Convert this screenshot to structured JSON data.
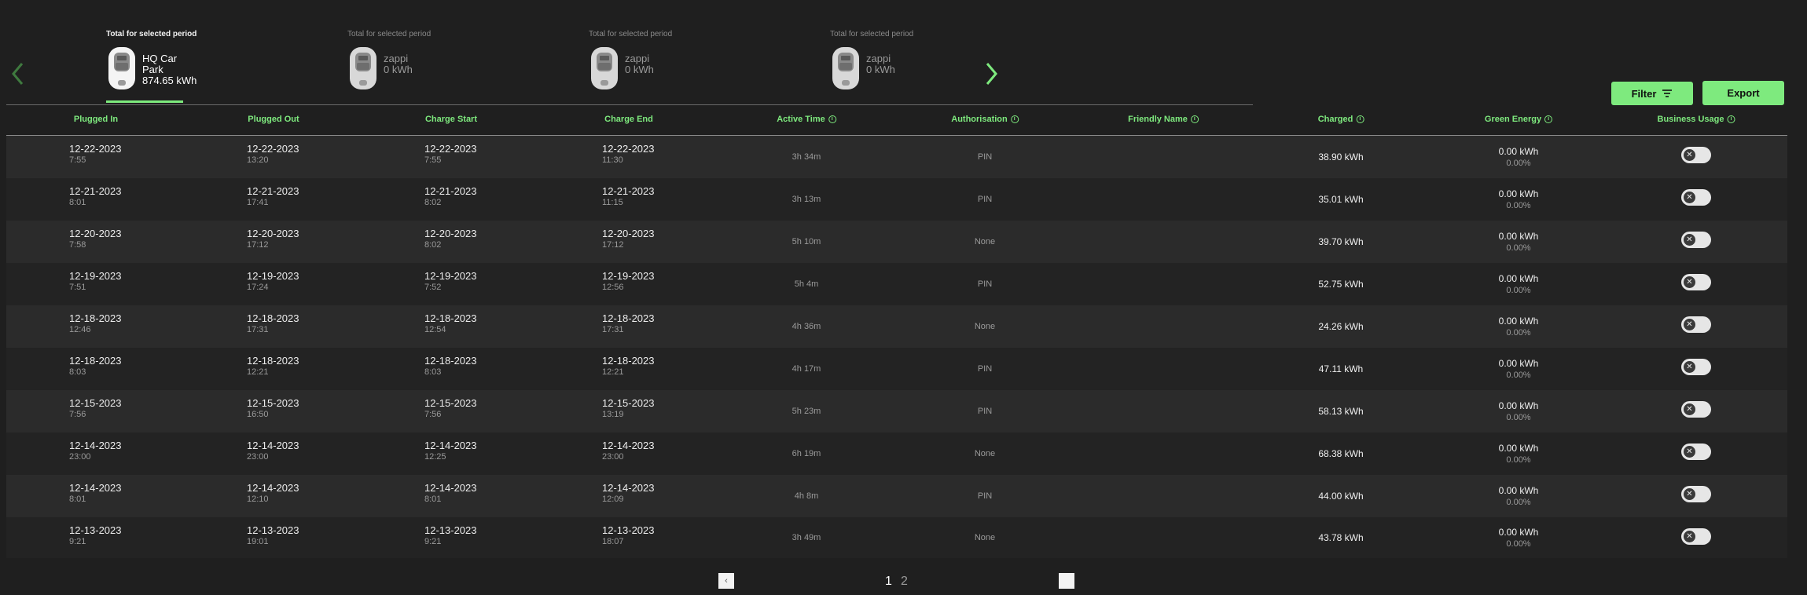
{
  "chargers": [
    {
      "period_label": "Total for selected period",
      "name": "HQ Car Park",
      "energy": "874.65 kWh",
      "active": true
    },
    {
      "period_label": "Total for selected period",
      "name": "zappi",
      "energy": "0 kWh",
      "active": false
    },
    {
      "period_label": "Total for selected period",
      "name": "zappi",
      "energy": "0 kWh",
      "active": false
    },
    {
      "period_label": "Total for selected period",
      "name": "zappi",
      "energy": "0 kWh",
      "active": false
    }
  ],
  "nav": {
    "prev_icon": "chevron-left-icon",
    "next_icon": "chevron-right-icon"
  },
  "buttons": {
    "filter_label": "Filter",
    "export_label": "Export"
  },
  "columns": {
    "plugged_in": "Plugged In",
    "plugged_out": "Plugged Out",
    "charge_start": "Charge Start",
    "charge_end": "Charge End",
    "active_time": "Active Time",
    "authorisation": "Authorisation",
    "friendly_name": "Friendly Name",
    "charged": "Charged",
    "green_energy": "Green Energy",
    "business_usage": "Business Usage"
  },
  "info_icon_glyph": "i",
  "toggle_glyph": "✕",
  "rows": [
    {
      "plugged_in": {
        "date": "12-22-2023",
        "time": "7:55"
      },
      "plugged_out": {
        "date": "12-22-2023",
        "time": "13:20"
      },
      "charge_start": {
        "date": "12-22-2023",
        "time": "7:55"
      },
      "charge_end": {
        "date": "12-22-2023",
        "time": "11:30"
      },
      "active_time": "3h 34m",
      "authorisation": "PIN",
      "friendly_name": "",
      "charged": "38.90 kWh",
      "green_kwh": "0.00 kWh",
      "green_pct": "0.00%",
      "business_usage": false
    },
    {
      "plugged_in": {
        "date": "12-21-2023",
        "time": "8:01"
      },
      "plugged_out": {
        "date": "12-21-2023",
        "time": "17:41"
      },
      "charge_start": {
        "date": "12-21-2023",
        "time": "8:02"
      },
      "charge_end": {
        "date": "12-21-2023",
        "time": "11:15"
      },
      "active_time": "3h 13m",
      "authorisation": "PIN",
      "friendly_name": "",
      "charged": "35.01 kWh",
      "green_kwh": "0.00 kWh",
      "green_pct": "0.00%",
      "business_usage": false
    },
    {
      "plugged_in": {
        "date": "12-20-2023",
        "time": "7:58"
      },
      "plugged_out": {
        "date": "12-20-2023",
        "time": "17:12"
      },
      "charge_start": {
        "date": "12-20-2023",
        "time": "8:02"
      },
      "charge_end": {
        "date": "12-20-2023",
        "time": "17:12"
      },
      "active_time": "5h 10m",
      "authorisation": "None",
      "friendly_name": "",
      "charged": "39.70 kWh",
      "green_kwh": "0.00 kWh",
      "green_pct": "0.00%",
      "business_usage": false
    },
    {
      "plugged_in": {
        "date": "12-19-2023",
        "time": "7:51"
      },
      "plugged_out": {
        "date": "12-19-2023",
        "time": "17:24"
      },
      "charge_start": {
        "date": "12-19-2023",
        "time": "7:52"
      },
      "charge_end": {
        "date": "12-19-2023",
        "time": "12:56"
      },
      "active_time": "5h 4m",
      "authorisation": "PIN",
      "friendly_name": "",
      "charged": "52.75 kWh",
      "green_kwh": "0.00 kWh",
      "green_pct": "0.00%",
      "business_usage": false
    },
    {
      "plugged_in": {
        "date": "12-18-2023",
        "time": "12:46"
      },
      "plugged_out": {
        "date": "12-18-2023",
        "time": "17:31"
      },
      "charge_start": {
        "date": "12-18-2023",
        "time": "12:54"
      },
      "charge_end": {
        "date": "12-18-2023",
        "time": "17:31"
      },
      "active_time": "4h 36m",
      "authorisation": "None",
      "friendly_name": "",
      "charged": "24.26 kWh",
      "green_kwh": "0.00 kWh",
      "green_pct": "0.00%",
      "business_usage": false
    },
    {
      "plugged_in": {
        "date": "12-18-2023",
        "time": "8:03"
      },
      "plugged_out": {
        "date": "12-18-2023",
        "time": "12:21"
      },
      "charge_start": {
        "date": "12-18-2023",
        "time": "8:03"
      },
      "charge_end": {
        "date": "12-18-2023",
        "time": "12:21"
      },
      "active_time": "4h 17m",
      "authorisation": "PIN",
      "friendly_name": "",
      "charged": "47.11 kWh",
      "green_kwh": "0.00 kWh",
      "green_pct": "0.00%",
      "business_usage": false
    },
    {
      "plugged_in": {
        "date": "12-15-2023",
        "time": "7:56"
      },
      "plugged_out": {
        "date": "12-15-2023",
        "time": "16:50"
      },
      "charge_start": {
        "date": "12-15-2023",
        "time": "7:56"
      },
      "charge_end": {
        "date": "12-15-2023",
        "time": "13:19"
      },
      "active_time": "5h 23m",
      "authorisation": "PIN",
      "friendly_name": "",
      "charged": "58.13 kWh",
      "green_kwh": "0.00 kWh",
      "green_pct": "0.00%",
      "business_usage": false
    },
    {
      "plugged_in": {
        "date": "12-14-2023",
        "time": "23:00"
      },
      "plugged_out": {
        "date": "12-14-2023",
        "time": "23:00"
      },
      "charge_start": {
        "date": "12-14-2023",
        "time": "12:25"
      },
      "charge_end": {
        "date": "12-14-2023",
        "time": "23:00"
      },
      "active_time": "6h 19m",
      "authorisation": "None",
      "friendly_name": "",
      "charged": "68.38 kWh",
      "green_kwh": "0.00 kWh",
      "green_pct": "0.00%",
      "business_usage": false
    },
    {
      "plugged_in": {
        "date": "12-14-2023",
        "time": "8:01"
      },
      "plugged_out": {
        "date": "12-14-2023",
        "time": "12:10"
      },
      "charge_start": {
        "date": "12-14-2023",
        "time": "8:01"
      },
      "charge_end": {
        "date": "12-14-2023",
        "time": "12:09"
      },
      "active_time": "4h 8m",
      "authorisation": "PIN",
      "friendly_name": "",
      "charged": "44.00 kWh",
      "green_kwh": "0.00 kWh",
      "green_pct": "0.00%",
      "business_usage": false
    },
    {
      "plugged_in": {
        "date": "12-13-2023",
        "time": "9:21"
      },
      "plugged_out": {
        "date": "12-13-2023",
        "time": "19:01"
      },
      "charge_start": {
        "date": "12-13-2023",
        "time": "9:21"
      },
      "charge_end": {
        "date": "12-13-2023",
        "time": "18:07"
      },
      "active_time": "3h 49m",
      "authorisation": "None",
      "friendly_name": "",
      "charged": "43.78 kWh",
      "green_kwh": "0.00 kWh",
      "green_pct": "0.00%",
      "business_usage": false
    }
  ],
  "pagination": {
    "prev_glyph": "‹",
    "next_glyph": "",
    "pages": [
      "1",
      "2"
    ],
    "current": "1"
  },
  "colors": {
    "accent": "#7eea7e",
    "background": "#1f1f1f",
    "row_odd": "#2b2b2b",
    "row_even": "#232323"
  }
}
